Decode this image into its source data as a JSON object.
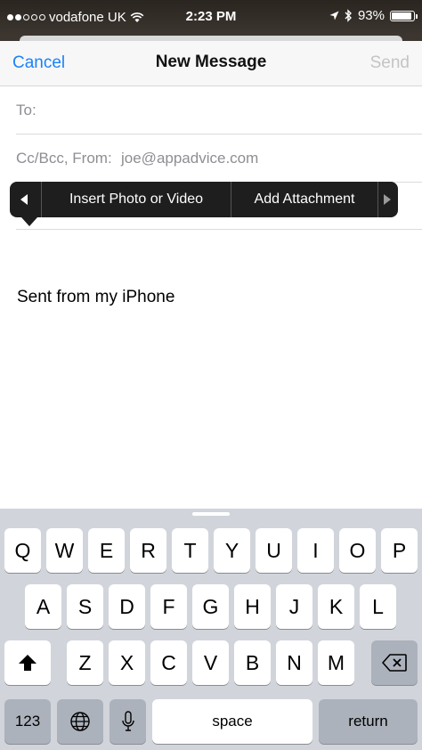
{
  "status_bar": {
    "carrier": "vodafone UK",
    "time": "2:23 PM",
    "battery_percent": "93%",
    "battery_level": 0.93,
    "signal_bars": 2,
    "icons": [
      "wifi-icon",
      "location-arrow-icon",
      "bluetooth-icon",
      "battery-icon"
    ]
  },
  "nav": {
    "cancel_label": "Cancel",
    "title": "New Message",
    "send_label": "Send"
  },
  "fields": {
    "to_label": "To:",
    "cc_label": "Cc/Bcc, From:",
    "cc_value": "joe@appadvice.com"
  },
  "popup": {
    "item1": "Insert Photo or Video",
    "item2": "Add Attachment"
  },
  "body": {
    "signature": "Sent from my iPhone"
  },
  "keyboard": {
    "row1": [
      "Q",
      "W",
      "E",
      "R",
      "T",
      "Y",
      "U",
      "I",
      "O",
      "P"
    ],
    "row2": [
      "A",
      "S",
      "D",
      "F",
      "G",
      "H",
      "J",
      "K",
      "L"
    ],
    "row3": [
      "Z",
      "X",
      "C",
      "V",
      "B",
      "N",
      "M"
    ],
    "numbers_label": "123",
    "space_label": "space",
    "return_label": "return"
  },
  "colors": {
    "accent": "#1a82fb",
    "disabled": "#c4c4c4",
    "popup_bg": "#1e1e1e",
    "keyboard_bg": "#d1d5db"
  }
}
